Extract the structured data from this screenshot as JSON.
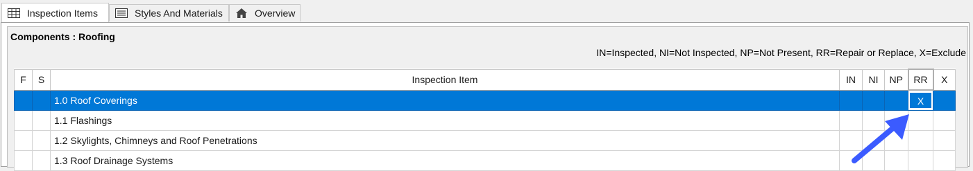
{
  "tabs": [
    {
      "label": "Inspection Items",
      "icon": "grid-icon"
    },
    {
      "label": "Styles And Materials",
      "icon": "list-icon"
    },
    {
      "label": "Overview",
      "icon": "home-icon"
    }
  ],
  "section": {
    "title": "Components : Roofing",
    "legend": "IN=Inspected, NI=Not Inspected, NP=Not Present, RR=Repair or Replace, X=Exclude"
  },
  "table": {
    "columns": [
      "F",
      "S",
      "Inspection Item",
      "IN",
      "NI",
      "NP",
      "RR",
      "X"
    ],
    "rows": [
      {
        "item": "1.0 Roof Coverings",
        "rr": "X",
        "selected": true
      },
      {
        "item": "1.1 Flashings",
        "rr": ""
      },
      {
        "item": "1.2 Skylights, Chimneys and Roof Penetrations",
        "rr": ""
      },
      {
        "item": "1.3 Roof Drainage Systems",
        "rr": ""
      }
    ]
  },
  "colors": {
    "selection": "#0078d7",
    "annotation_arrow": "#3b5bff"
  }
}
